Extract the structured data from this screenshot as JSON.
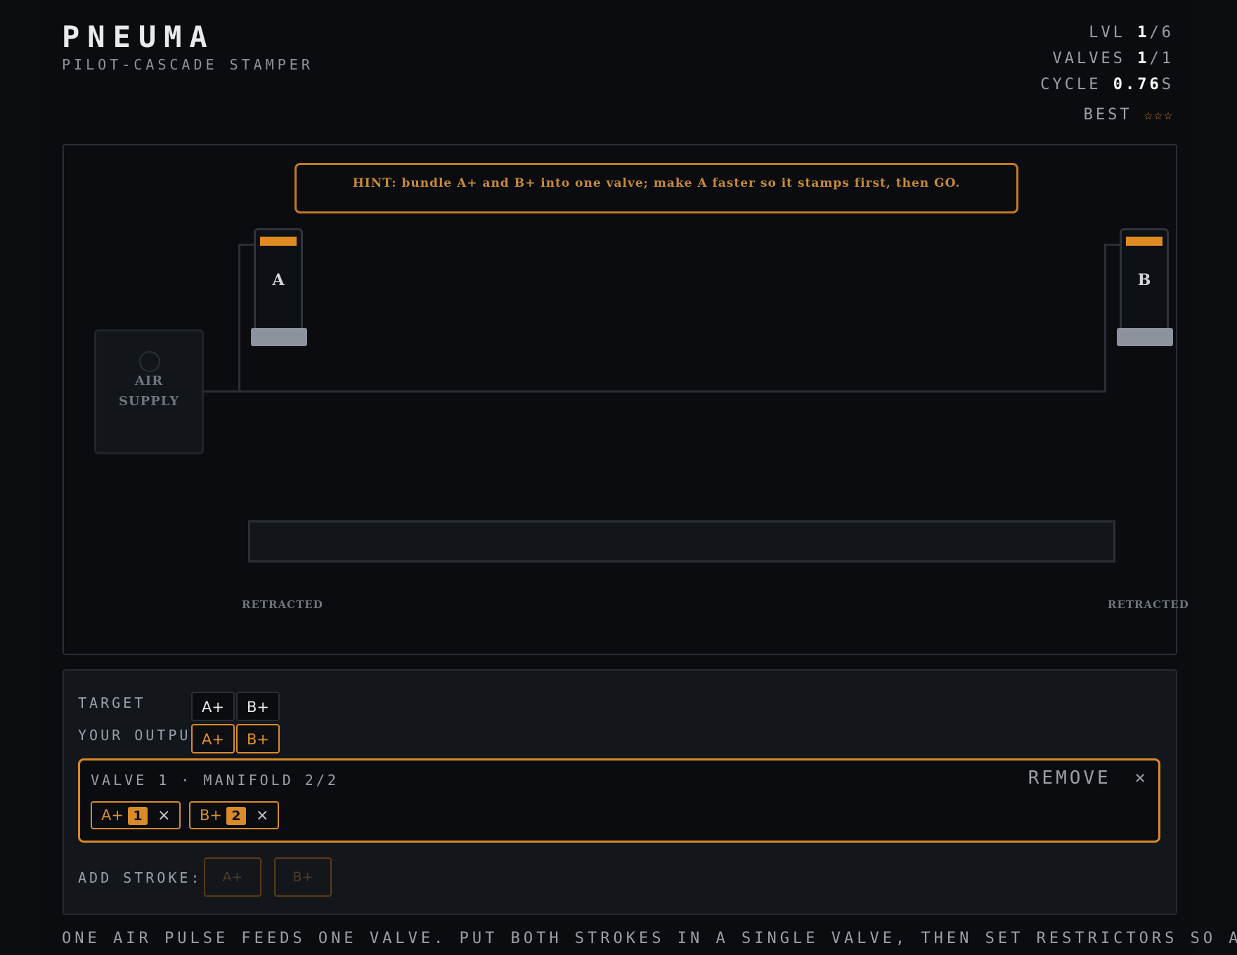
{
  "header": {
    "title": "PNEUMA",
    "subtitle": "PILOT-CASCADE STAMPER"
  },
  "stats": {
    "level_label": "LVL",
    "level_current": "1",
    "level_total": "/6",
    "valves_label": "VALVES",
    "valves_current": "1",
    "valves_total": "/1",
    "cycle_label": "CYCLE",
    "cycle_value": "0.76",
    "cycle_unit": "S",
    "best_label": "BEST",
    "best_stars": "☆☆☆"
  },
  "board": {
    "hint": "HINT: bundle A+ and B+ into one valve; make A faster so it stamps first, then GO.",
    "cylinders": [
      {
        "label": "A",
        "state": "RETRACTED"
      },
      {
        "label": "B",
        "state": "RETRACTED"
      }
    ],
    "air_supply": [
      "AIR",
      "SUPPLY"
    ]
  },
  "panel": {
    "target_label": "TARGET",
    "target": [
      "A+",
      "B+"
    ],
    "output_label": "YOUR OUTPUT",
    "output": [
      "A+",
      "B+"
    ],
    "valve": {
      "title": "VALVE 1 · MANIFOLD 2/2",
      "remove_label": "REMOVE",
      "remove_icon": "×",
      "strokes": [
        {
          "stroke": "A+",
          "restrictor": "1"
        },
        {
          "stroke": "B+",
          "restrictor": "2"
        }
      ],
      "stroke_remove_icon": "×"
    },
    "add_stroke_label": "ADD STROKE:",
    "add_stroke_options": [
      "A+",
      "B+"
    ]
  },
  "footer": {
    "instructions": "ONE AIR PULSE FEEDS ONE VALVE. PUT BOTH STROKES IN A SINGLE VALVE, THEN SET RESTRICTORS SO A"
  },
  "colors": {
    "accent": "#d98a2a",
    "background": "#0a0c0f",
    "rod": "#8c939c"
  }
}
